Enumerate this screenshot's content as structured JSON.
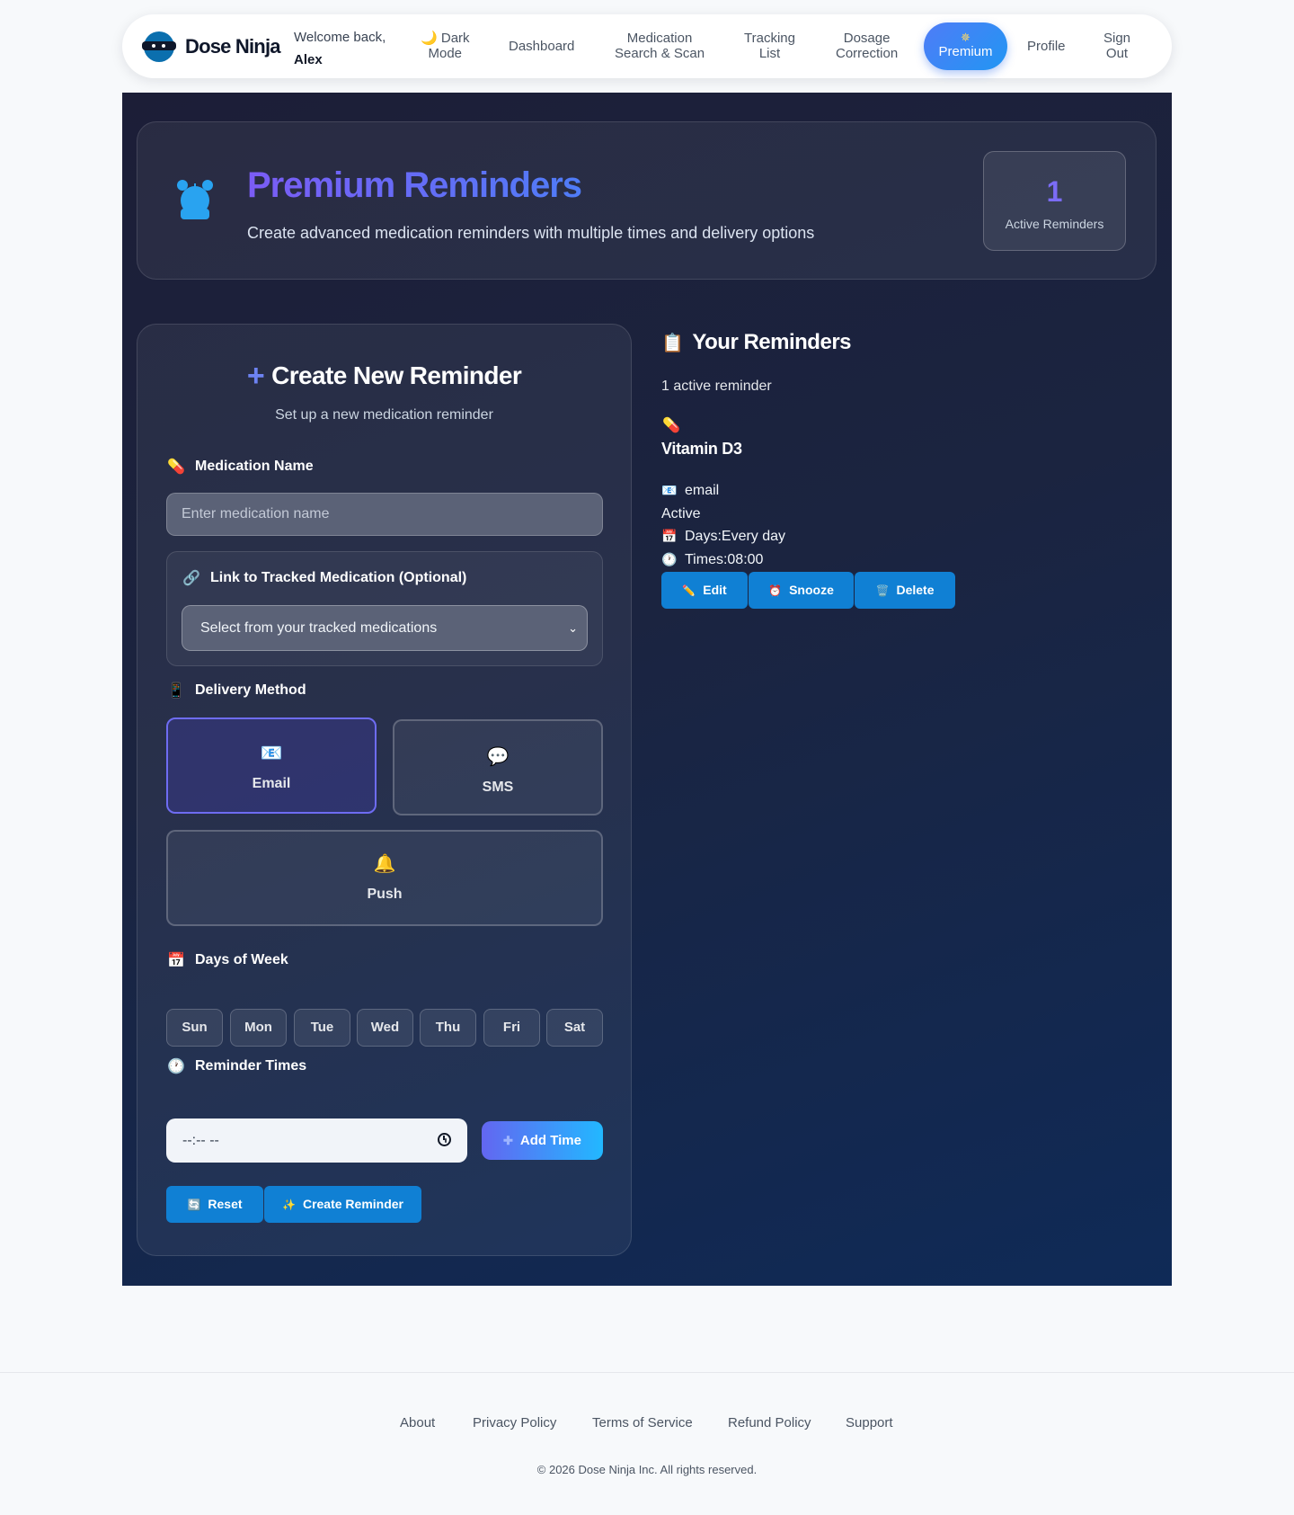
{
  "brand": {
    "name": "Dose Ninja"
  },
  "welcome": {
    "greeting": "Welcome back,",
    "user": "Alex"
  },
  "nav": {
    "dark_mode_icon": "🌙",
    "dark_mode_line1": "Dark",
    "dark_mode_line2": "Mode",
    "dashboard": "Dashboard",
    "med_search_line1": "Medication",
    "med_search_line2": "Search & Scan",
    "tracking_line1": "Tracking",
    "tracking_line2": "List",
    "dosage_line1": "Dosage",
    "dosage_line2": "Correction",
    "premium_icon": "✵",
    "premium": "Premium",
    "profile": "Profile",
    "signout_line1": "Sign",
    "signout_line2": "Out"
  },
  "hero": {
    "icon": "alarm-clock-icon",
    "title": "Premium Reminders",
    "subtitle": "Create advanced medication reminders with multiple times and delivery options",
    "stat_value": "1",
    "stat_label": "Active Reminders"
  },
  "form": {
    "title_icon": "+",
    "title": "Create New Reminder",
    "subtitle": "Set up a new medication reminder",
    "med_name_icon": "💊",
    "med_name_label": "Medication Name",
    "med_name_placeholder": "Enter medication name",
    "link_icon": "🔗",
    "link_label": "Link to Tracked Medication (Optional)",
    "link_select": "Select from your tracked medications",
    "delivery_icon": "📱",
    "delivery_label": "Delivery Method",
    "methods": [
      {
        "icon": "📧",
        "label": "Email",
        "selected": true
      },
      {
        "icon": "💬",
        "label": "SMS",
        "selected": false
      },
      {
        "icon": "🔔",
        "label": "Push",
        "selected": false
      }
    ],
    "days_icon": "📅",
    "days_label": "Days of Week",
    "days": [
      "Sun",
      "Mon",
      "Tue",
      "Wed",
      "Thu",
      "Fri",
      "Sat"
    ],
    "times_icon": "🕐",
    "times_label": "Reminder Times",
    "time_value": "--:-- --",
    "add_time_icon": "✚",
    "add_time": "Add Time",
    "reset_icon": "🔄",
    "reset": "Reset",
    "create_icon": "✨",
    "create": "Create Reminder"
  },
  "reminders": {
    "title_icon": "📋",
    "title": "Your Reminders",
    "count": "1 active reminder",
    "items": [
      {
        "icon": "💊",
        "name": "Vitamin D3",
        "method_icon": "📧",
        "method": "email",
        "status": "Active",
        "days_icon": "📅",
        "days": "Days:Every day",
        "times_icon": "🕐",
        "times": "Times:08:00",
        "edit_icon": "✏️",
        "edit": "Edit",
        "snooze_icon": "⏰",
        "snooze": "Snooze",
        "delete_icon": "🗑️",
        "delete": "Delete"
      }
    ]
  },
  "footer": {
    "links": [
      "About",
      "Privacy Policy",
      "Terms of Service",
      "Refund Policy",
      "Support"
    ],
    "copyright": "© 2026 Dose Ninja Inc. All rights reserved."
  },
  "colors": {
    "accent": "#4f7cf7",
    "button_blue": "#1080d4",
    "stat_purple": "#7b6cf6",
    "page_bg": "#f7f9fb",
    "panel_dark": "#1b2440"
  }
}
